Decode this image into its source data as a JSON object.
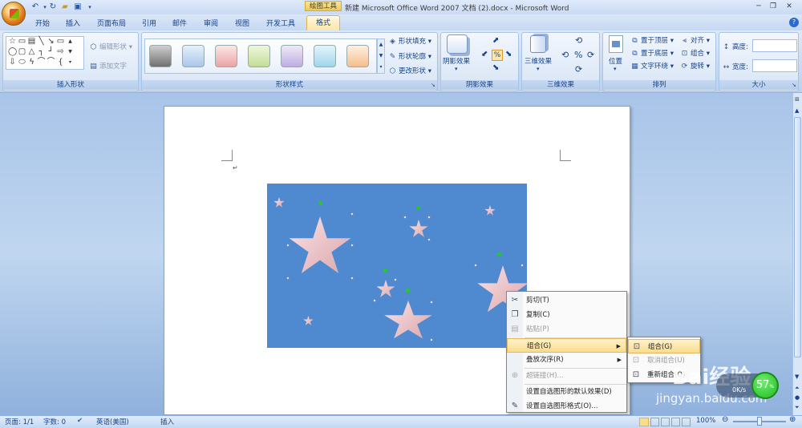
{
  "window": {
    "title": "新建 Microsoft Office Word 2007 文档 (2).docx - Microsoft Word",
    "context_tab_title": "绘图工具",
    "quick_access": [
      "undo-icon",
      "redo-icon",
      "open-icon",
      "save-icon",
      "customize-icon"
    ]
  },
  "tabs": [
    "开始",
    "插入",
    "页面布局",
    "引用",
    "邮件",
    "审阅",
    "视图",
    "开发工具"
  ],
  "active_tab": "格式",
  "ribbon": {
    "insert_shapes": {
      "label": "插入形状",
      "edit_shape": "编辑形状",
      "add_text": "添加文字"
    },
    "shape_styles": {
      "label": "形状样式",
      "fill": "形状填充",
      "outline": "形状轮廓",
      "change": "更改形状"
    },
    "shadow": {
      "label": "阴影效果",
      "button": "阴影效果"
    },
    "threed": {
      "label": "三维效果",
      "button": "三维效果"
    },
    "arrange": {
      "label": "排列",
      "position": "位置",
      "bring_front": "置于顶层",
      "send_back": "置于底层",
      "wrap": "文字环绕",
      "align": "对齐",
      "group": "组合",
      "rotate": "旋转"
    },
    "size": {
      "label": "大小",
      "height": "高度:",
      "width": "宽度:",
      "height_value": "",
      "width_value": ""
    }
  },
  "context_menu": {
    "items": [
      {
        "label": "剪切(T)",
        "icon": "scissors-icon",
        "disabled": false
      },
      {
        "label": "复制(C)",
        "icon": "copy-icon",
        "disabled": false
      },
      {
        "label": "粘贴(P)",
        "icon": "paste-icon",
        "disabled": true
      },
      {
        "label": "组合(G)",
        "icon": "",
        "disabled": false,
        "highlighted": true,
        "submenu": true
      },
      {
        "label": "叠放次序(R)",
        "icon": "",
        "disabled": false,
        "submenu": true
      },
      {
        "label": "超链接(H)...",
        "icon": "hyperlink-icon",
        "disabled": true
      },
      {
        "label": "设置自选图形的默认效果(D)",
        "icon": "",
        "disabled": false
      },
      {
        "label": "设置自选图形格式(O)...",
        "icon": "format-shape-icon",
        "disabled": false
      }
    ]
  },
  "submenu": {
    "items": [
      {
        "label": "组合(G)",
        "highlighted": true
      },
      {
        "label": "取消组合(U)",
        "disabled": true
      },
      {
        "label": "重新组合(O)",
        "disabled": false
      }
    ]
  },
  "statusbar": {
    "page": "页面: 1/1",
    "words": "字数: 0",
    "language": "英语(美国)",
    "mode": "插入",
    "zoom": "100%"
  },
  "net_widget": {
    "percent": "57",
    "unit": "%",
    "speed": "0K/s"
  },
  "watermark": {
    "text": "Bai经验",
    "url": "jingyan.baidu.com"
  },
  "colors": {
    "accent": "#fbdc8d",
    "canvas": "#4f89cf",
    "ribbon": "#c4d8f0"
  }
}
